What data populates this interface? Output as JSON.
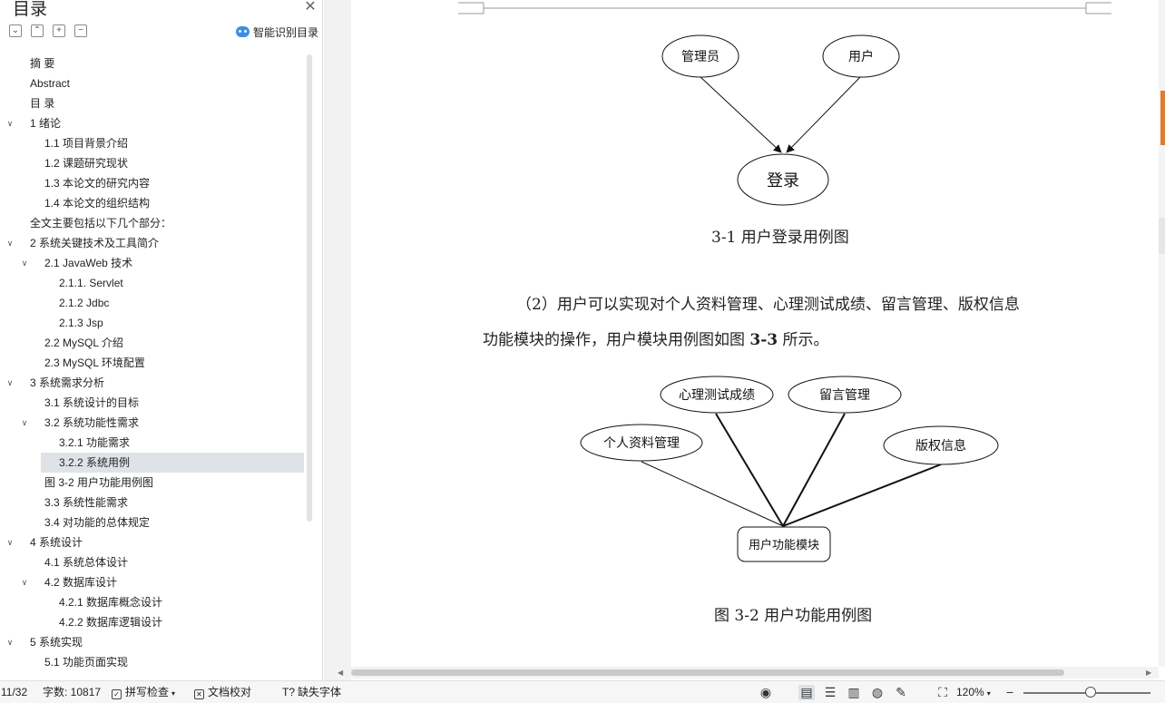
{
  "toc": {
    "title": "目录",
    "smart_label": "智能识别目录",
    "items": [
      {
        "label": "摘  要",
        "level": 0,
        "expand": false
      },
      {
        "label": "Abstract",
        "level": 0,
        "expand": false
      },
      {
        "label": "目  录",
        "level": 0,
        "expand": false
      },
      {
        "label": "1  绪论",
        "level": 0,
        "expand": true
      },
      {
        "label": "1.1 项目背景介绍",
        "level": 1,
        "expand": false
      },
      {
        "label": "1.2 课题研究现状",
        "level": 1,
        "expand": false
      },
      {
        "label": "1.3 本论文的研究内容",
        "level": 1,
        "expand": false
      },
      {
        "label": "1.4 本论文的组织结构",
        "level": 1,
        "expand": false
      },
      {
        "label": "全文主要包括以下几个部分：",
        "level": 0,
        "expand": false
      },
      {
        "label": "2 系统关键技术及工具简介",
        "level": 0,
        "expand": true
      },
      {
        "label": "2.1    JavaWeb 技术",
        "level": 1,
        "expand": true
      },
      {
        "label": "2.1.1. Servlet",
        "level": 2,
        "expand": false
      },
      {
        "label": "2.1.2 Jdbc",
        "level": 2,
        "expand": false
      },
      {
        "label": "2.1.3 Jsp",
        "level": 2,
        "expand": false
      },
      {
        "label": "2.2 MySQL  介绍",
        "level": 1,
        "expand": false
      },
      {
        "label": "2.3 MySQL 环境配置",
        "level": 1,
        "expand": false
      },
      {
        "label": "3 系统需求分析",
        "level": 0,
        "expand": true
      },
      {
        "label": "3.1 系统设计的目标",
        "level": 1,
        "expand": false
      },
      {
        "label": "3.2 系统功能性需求",
        "level": 1,
        "expand": true
      },
      {
        "label": "3.2.1  功能需求",
        "level": 2,
        "expand": false
      },
      {
        "label": "3.2.2  系统用例",
        "level": 2,
        "expand": false,
        "selected": true
      },
      {
        "label": "图 3-2 用户功能用例图",
        "level": 1,
        "expand": false
      },
      {
        "label": "3.3 系统性能需求",
        "level": 1,
        "expand": false
      },
      {
        "label": "3.4 对功能的总体规定",
        "level": 1,
        "expand": false
      },
      {
        "label": "4 系统设计",
        "level": 0,
        "expand": true
      },
      {
        "label": "4.1 系统总体设计",
        "level": 1,
        "expand": false
      },
      {
        "label": "4.2 数据库设计",
        "level": 1,
        "expand": true
      },
      {
        "label": "4.2.1  数据库概念设计",
        "level": 2,
        "expand": false
      },
      {
        "label": "4.2.2  数据库逻辑设计",
        "level": 2,
        "expand": false
      },
      {
        "label": "5 系统实现",
        "level": 0,
        "expand": true
      },
      {
        "label": "5.1 功能页面实现",
        "level": 1,
        "expand": false
      }
    ]
  },
  "doc": {
    "diagram1": {
      "actor_admin": "管理员",
      "actor_user": "用户",
      "usecase_login": "登录",
      "caption": "3-1  用户登录用例图"
    },
    "paragraph": {
      "line1": "（2）用户可以实现对个人资料管理、心理测试成绩、留言管理、版权信息",
      "line2_a": "功能模块的操作，用户模块用例图如图 ",
      "line2_b": "3-3",
      "line2_c": " 所示。"
    },
    "diagram2": {
      "uc_test": "心理测试成绩",
      "uc_message": "留言管理",
      "uc_profile": "个人资料管理",
      "uc_copyright": "版权信息",
      "module": "用户功能模块",
      "caption": "图 3-2 用户功能用例图"
    }
  },
  "status": {
    "page": "11/32",
    "word_count": "字数: 10817",
    "spell_check": "拼写检查",
    "doc_proof": "文档校对",
    "missing_fonts": "缺失字体",
    "zoom": "120%"
  }
}
